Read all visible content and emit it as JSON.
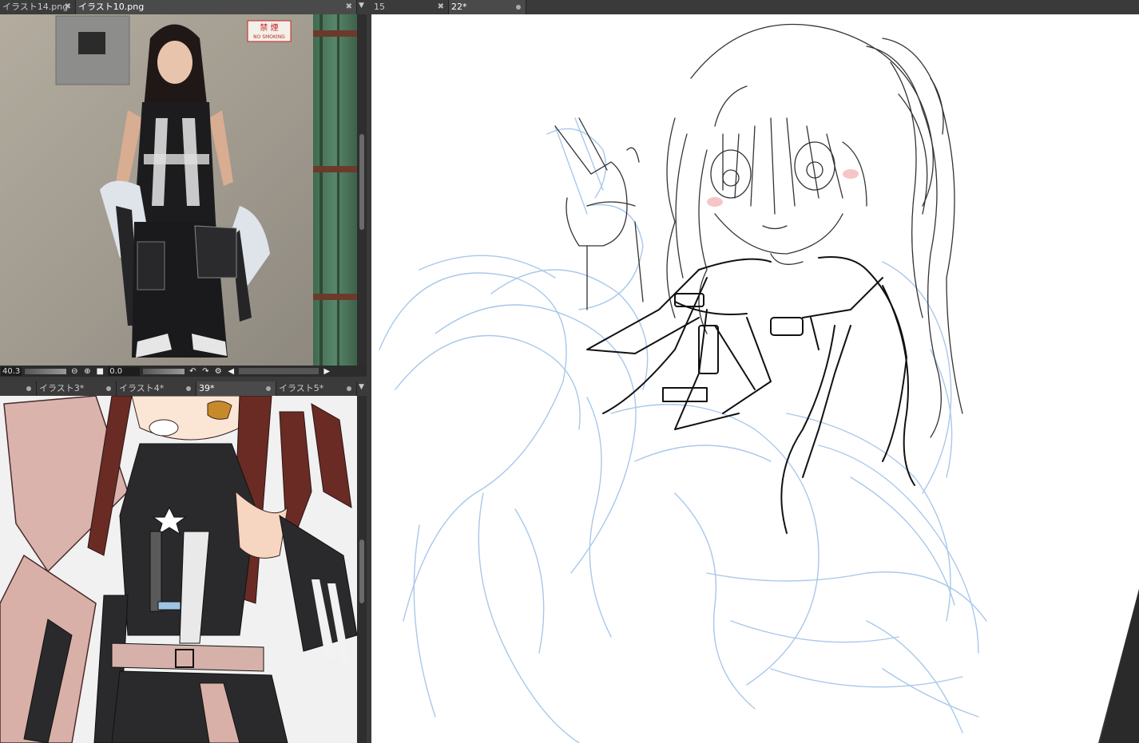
{
  "top_left_tabs": [
    {
      "label": "イラスト14.png",
      "active": false
    },
    {
      "label": "イラスト10.png",
      "active": true
    }
  ],
  "right_tabs": [
    {
      "label": "15",
      "active": false
    },
    {
      "label": "22*",
      "active": true
    }
  ],
  "bottom_left_tabs": [
    {
      "label": "イラスト3*"
    },
    {
      "label": "イラスト4*"
    },
    {
      "label": "39*"
    },
    {
      "label": "イラスト5*"
    }
  ],
  "photo_panel": {
    "sign_kanji": "禁 煙",
    "sign_english": "NO SMOKING"
  },
  "status_bar": {
    "zoom": "40.3",
    "rotation": "0.0"
  },
  "colors": {
    "ui_dark": "#2f2f2f",
    "sketch_blue": "#a9c8ea",
    "line_dark": "#111111"
  }
}
